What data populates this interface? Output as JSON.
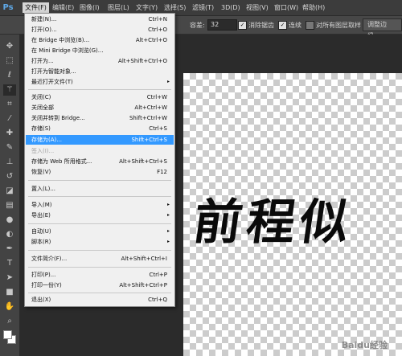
{
  "app": {
    "logo": "Ps"
  },
  "menubar": {
    "items": [
      "文件(F)",
      "编辑(E)",
      "图像(I)",
      "图层(L)",
      "文字(Y)",
      "选择(S)",
      "滤镜(T)",
      "3D(D)",
      "视图(V)",
      "窗口(W)",
      "帮助(H)"
    ]
  },
  "options": {
    "tolerance_label": "容差:",
    "tolerance_value": "32",
    "antialias_label": "消除锯齿",
    "contiguous_label": "连续",
    "sample_all_label": "对所有图层取样",
    "refine_edge_label": "调整边缘..."
  },
  "file_menu": {
    "items": [
      {
        "label": "新建(N)...",
        "shortcut": "Ctrl+N"
      },
      {
        "label": "打开(O)...",
        "shortcut": "Ctrl+O"
      },
      {
        "label": "在 Bridge 中浏览(B)...",
        "shortcut": "Alt+Ctrl+O"
      },
      {
        "label": "在 Mini Bridge 中浏览(G)...",
        "shortcut": ""
      },
      {
        "label": "打开为...",
        "shortcut": "Alt+Shift+Ctrl+O"
      },
      {
        "label": "打开为智能对象...",
        "shortcut": ""
      },
      {
        "label": "最近打开文件(T)",
        "shortcut": "",
        "submenu": "▸"
      },
      {
        "label": "关闭(C)",
        "shortcut": "Ctrl+W"
      },
      {
        "label": "关闭全部",
        "shortcut": "Alt+Ctrl+W"
      },
      {
        "label": "关闭并转到 Bridge...",
        "shortcut": "Shift+Ctrl+W"
      },
      {
        "label": "存储(S)",
        "shortcut": "Ctrl+S"
      },
      {
        "label": "存储为(A)...",
        "shortcut": "Shift+Ctrl+S",
        "highlighted": true
      },
      {
        "label": "签入(I)...",
        "shortcut": "",
        "disabled": true
      },
      {
        "label": "存储为 Web 所用格式...",
        "shortcut": "Alt+Shift+Ctrl+S"
      },
      {
        "label": "恢复(V)",
        "shortcut": "F12"
      },
      {
        "label": "置入(L)...",
        "shortcut": ""
      },
      {
        "label": "导入(M)",
        "shortcut": "",
        "submenu": "▸"
      },
      {
        "label": "导出(E)",
        "shortcut": "",
        "submenu": "▸"
      },
      {
        "label": "自动(U)",
        "shortcut": "",
        "submenu": "▸"
      },
      {
        "label": "脚本(R)",
        "shortcut": "",
        "submenu": "▸"
      },
      {
        "label": "文件简介(F)...",
        "shortcut": "Alt+Shift+Ctrl+I"
      },
      {
        "label": "打印(P)...",
        "shortcut": "Ctrl+P"
      },
      {
        "label": "打印一份(Y)",
        "shortcut": "Alt+Shift+Ctrl+P"
      },
      {
        "label": "退出(X)",
        "shortcut": "Ctrl+Q"
      }
    ]
  },
  "canvas": {
    "text": "前程似",
    "watermark": "Baidu经验"
  },
  "colors": {
    "highlight": "#3399ff",
    "menu_bg": "#f0f0f0",
    "ui_dark": "#3c3c3c"
  },
  "tools": [
    "move-icon",
    "marquee-icon",
    "lasso-icon",
    "magic-wand-icon",
    "crop-icon",
    "eyedropper-icon",
    "healing-brush-icon",
    "brush-icon",
    "clone-stamp-icon",
    "history-brush-icon",
    "eraser-icon",
    "gradient-icon",
    "blur-icon",
    "dodge-icon",
    "pen-icon",
    "type-icon",
    "path-selection-icon",
    "shape-icon",
    "hand-icon",
    "zoom-icon"
  ]
}
